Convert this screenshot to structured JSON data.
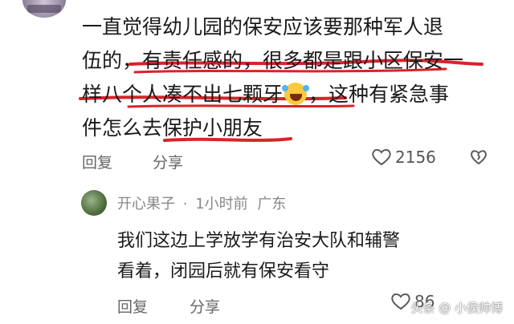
{
  "comment": {
    "lines": [
      "一直觉得幼儿园的保安应该要那种军人退",
      "伍的，有责任感的，很多都是跟小区保安一",
      "样八个人凑不出七颗牙",
      "，这种有紧急事",
      "件怎么去保护小朋友"
    ],
    "emoji": "rolling-on-floor-laughing-emoji",
    "reply_label": "回复",
    "share_label": "分享",
    "like_count": "2156"
  },
  "reply": {
    "username": "开心果子",
    "dot": "·",
    "time": "1小时前",
    "location": "广东",
    "lines": [
      "我们这边上学放学有治安大队和辅警",
      "看着，闭园后就有保安看守"
    ],
    "reply_label": "回复",
    "share_label": "分享",
    "like_count": "86"
  },
  "watermark": "头条 @ 小侯帅博",
  "colors": {
    "annotation": "#d9232a",
    "muted": "#888888"
  }
}
